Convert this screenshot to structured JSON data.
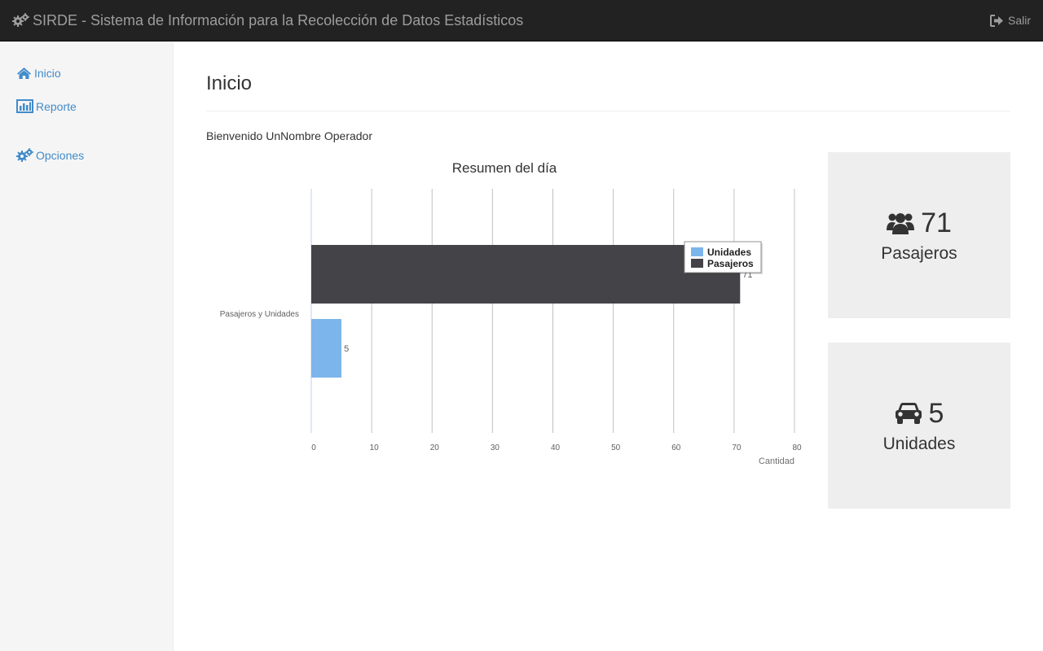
{
  "navbar": {
    "title": "SIRDE - Sistema de Información para la Recolección de Datos Estadísticos",
    "brand_icon": "gears-icon",
    "logout_label": "Salir",
    "logout_icon": "sign-out-icon",
    "background": "#222222",
    "text_color": "#9d9d9d"
  },
  "sidebar": {
    "items": [
      {
        "label": "Inicio",
        "icon": "home-icon"
      },
      {
        "label": "Reporte",
        "icon": "bar-chart-icon"
      },
      {
        "label": "Opciones",
        "icon": "gears-icon"
      }
    ],
    "link_color": "#428bca"
  },
  "main": {
    "title": "Inicio",
    "welcome_prefix": "Bienvenido",
    "welcome_name": "UnNombre Operador"
  },
  "chart_data": {
    "type": "bar",
    "orientation": "horizontal",
    "title": "Resumen del día",
    "categories": [
      "Pasajeros y Unidades"
    ],
    "series": [
      {
        "name": "Unidades",
        "values": [
          5
        ],
        "color": "#7cb5ec"
      },
      {
        "name": "Pasajeros",
        "values": [
          71
        ],
        "color": "#434348"
      }
    ],
    "xlabel": "Cantidad",
    "xlim": [
      0,
      80
    ],
    "ticks": [
      0,
      10,
      20,
      30,
      40,
      50,
      60,
      70,
      80
    ],
    "grid": true,
    "legend_position": "top-right"
  },
  "stats": [
    {
      "value": "71",
      "label": "Pasajeros",
      "icon": "users-icon"
    },
    {
      "value": "5",
      "label": "Unidades",
      "icon": "car-icon"
    }
  ]
}
